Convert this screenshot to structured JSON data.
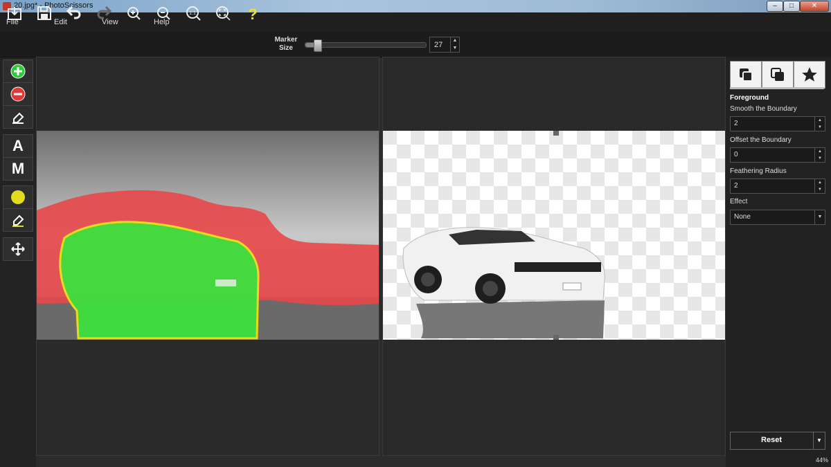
{
  "window": {
    "title": "20.jpg* - PhotoScissors",
    "min": "–",
    "max": "□",
    "close": "✕"
  },
  "menu": [
    "File",
    "Edit",
    "View",
    "Help"
  ],
  "toolbar": {
    "buttons": [
      "open-icon",
      "save-icon",
      "undo-icon",
      "redo-icon",
      "zoom-in-icon",
      "zoom-out-icon",
      "zoom-actual-icon",
      "zoom-fit-icon",
      "help-icon"
    ],
    "marker_label_1": "Marker",
    "marker_label_2": "Size",
    "marker_size": "27",
    "marker_slider_fraction": 0.1
  },
  "left_tools": {
    "letter_a": "A",
    "letter_m": "M"
  },
  "right_panel": {
    "section": "Foreground",
    "smooth_label": "Smooth the Boundary",
    "smooth_value": "2",
    "offset_label": "Offset the Boundary",
    "offset_value": "0",
    "feather_label": "Feathering Radius",
    "feather_value": "2",
    "effect_label": "Effect",
    "effect_value": "None",
    "reset_label": "Reset"
  },
  "status": {
    "zoom": "44%"
  },
  "colors": {
    "keep_marker": "#3ee03e",
    "remove_marker": "#e8474a",
    "boundary": "#f0e11a"
  }
}
